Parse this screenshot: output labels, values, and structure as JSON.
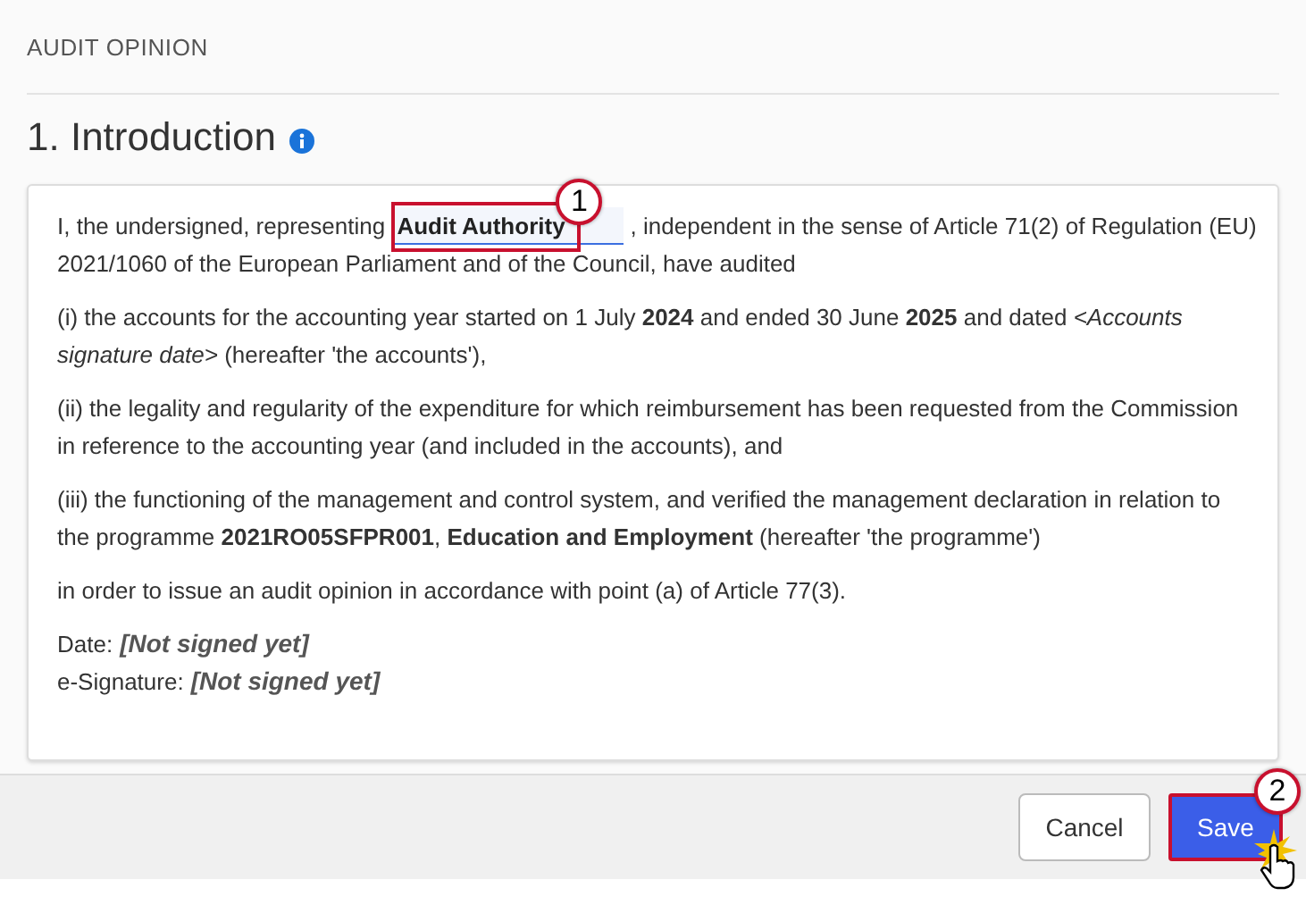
{
  "section_title": "AUDIT OPINION",
  "heading": "1. Introduction",
  "intro": {
    "before": "I, the undersigned, representing",
    "field_value": "Audit Authority",
    "callout": "1",
    "after": ", independent in the sense of Article 71(2) of Regulation (EU)",
    "continuation": "2021/1060 of the European Parliament and of the Council, have audited"
  },
  "paragraphs": [
    "(i) the accounts for the accounting year started on 1 July **2024** and ended 30 June **2025** and dated *<Accounts signature date>* (hereafter 'the accounts'),",
    "(ii) the legality and regularity of the expenditure for which reimbursement has been requested from the Commission in reference to the accounting year (and included in the accounts), and",
    "(iii) the functioning of the management and control system, and verified the management declaration in relation to the programme **2021RO05SFPR001**, **Education and Employment** (hereafter 'the programme')",
    "in order to issue an audit opinion in accordance with point (a) of Article 77(3)."
  ],
  "signature": [
    {
      "label": "Date:",
      "value": "[Not signed yet]"
    },
    {
      "label": "e-Signature:",
      "value": "[Not signed yet]"
    }
  ],
  "buttons": [
    {
      "label": "Cancel",
      "kind": "secondary"
    },
    {
      "label": "Save",
      "kind": "primary",
      "callout": "2"
    }
  ]
}
